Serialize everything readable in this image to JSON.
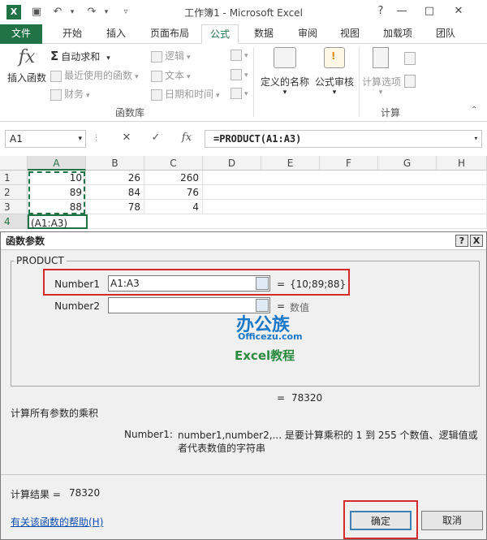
{
  "titlebar": {
    "title": "工作簿1 - Microsoft Excel",
    "logo": "X",
    "help_icon": "?",
    "minimize_icon": "—",
    "restore_icon": "□",
    "close_icon": "✕"
  },
  "tabs": [
    "文件",
    "开始",
    "插入",
    "页面布局",
    "公式",
    "数据",
    "审阅",
    "视图",
    "加载项",
    "团队"
  ],
  "active_tab": "公式",
  "ribbon": {
    "insert_function": "插入函数",
    "autosum": "自动求和",
    "recent": "最近使用的函数",
    "finance": "财务",
    "logic": "逻辑",
    "text": "文本",
    "datetime": "日期和时间",
    "defined_names": "定义的名称",
    "formula_audit": "公式审核",
    "calc_options": "计算选项",
    "group_library": "函数库",
    "group_calc": "计算"
  },
  "formula_bar": {
    "name_box": "A1",
    "cancel": "✕",
    "enter": "✓",
    "fx": "fx",
    "formula": "=PRODUCT(A1:A3)"
  },
  "grid": {
    "columns": [
      "A",
      "B",
      "C",
      "D",
      "E",
      "F",
      "G",
      "H"
    ],
    "rows": [
      {
        "num": "1",
        "cells": [
          "10",
          "26",
          "260"
        ]
      },
      {
        "num": "2",
        "cells": [
          "89",
          "84",
          "76"
        ]
      },
      {
        "num": "3",
        "cells": [
          "88",
          "78",
          "4"
        ]
      },
      {
        "num": "4",
        "cells": [
          "(A1:A3)",
          "",
          ""
        ]
      }
    ]
  },
  "dialog": {
    "title": "函数参数",
    "help_btn": "?",
    "close_btn": "X",
    "function_name": "PRODUCT",
    "arg1_label": "Number1",
    "arg1_value": "A1:A3",
    "arg1_result": "{10;89;88}",
    "arg2_label": "Number2",
    "arg2_value": "",
    "arg2_result": "数值",
    "equals": "=",
    "formula_result_inline": "78320",
    "description": "计算所有参数的乘积",
    "arg_help_label": "Number1:",
    "arg_help_text": "number1,number2,... 是要计算乘积的 1 到 255 个数值、逻辑值或者代表数值的字符串",
    "result_label": "计算结果 =",
    "result_value": "78320",
    "help_link": "有关该函数的帮助(H)",
    "ok": "确定",
    "cancel": "取消"
  },
  "watermark": {
    "brand": "办公族",
    "site": "Officezu.com",
    "caption": "Excel教程"
  },
  "colors": {
    "excel_green": "#217346",
    "highlight_red": "#d42a2a"
  }
}
